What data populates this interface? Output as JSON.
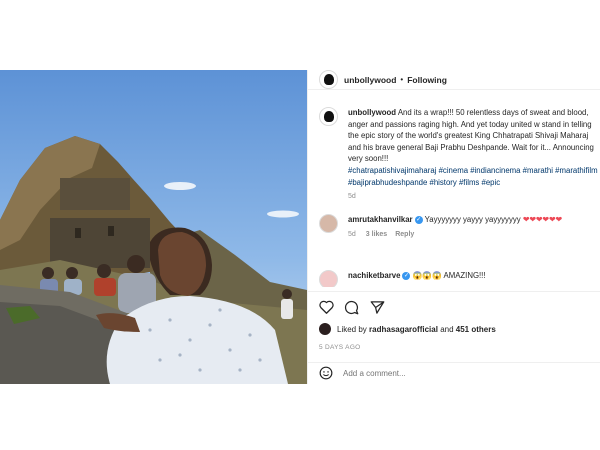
{
  "post": {
    "username": "unbollywood",
    "header_separator": "•",
    "follow_status": "Following"
  },
  "caption": {
    "username": "unbollywood",
    "text": "And its a wrap!!! 50 relentless days of sweat and blood, anger and passions raging high. And yet today united w stand in telling the epic story of the world's greatest King Chhatrapati Shivaji Maharaj and his brave general Baji Prabhu Deshpande. Wait for it... Announcing very soon!!!",
    "hashtags": "#chatrapatishivajimaharaj #cinema #indiancinema #marathi #marathifilm #bajiprabhudeshpande #history #films #epic",
    "age": "5d"
  },
  "comments": [
    {
      "username": "amrutakhanvilkar",
      "verified": true,
      "text": "Yayyyyyyy yayyy yayyyyyyy",
      "emoji": "❤❤❤❤❤❤",
      "age": "5d",
      "likes": "3 likes",
      "reply_label": "Reply"
    },
    {
      "username": "nachiketbarve",
      "verified": true,
      "emoji": "😱😱😱",
      "text": "AMAZING!!!"
    }
  ],
  "engagement": {
    "liked_by_prefix": "Liked by",
    "liked_by_user": "radhasagarofficial",
    "and_label": "and",
    "others": "451 others"
  },
  "timestamp": "5 DAYS AGO",
  "add_comment": {
    "placeholder": "Add a comment..."
  },
  "icons": {
    "like": "heart-icon",
    "comment": "comment-icon",
    "share": "send-icon",
    "emoji": "smiley-icon"
  }
}
